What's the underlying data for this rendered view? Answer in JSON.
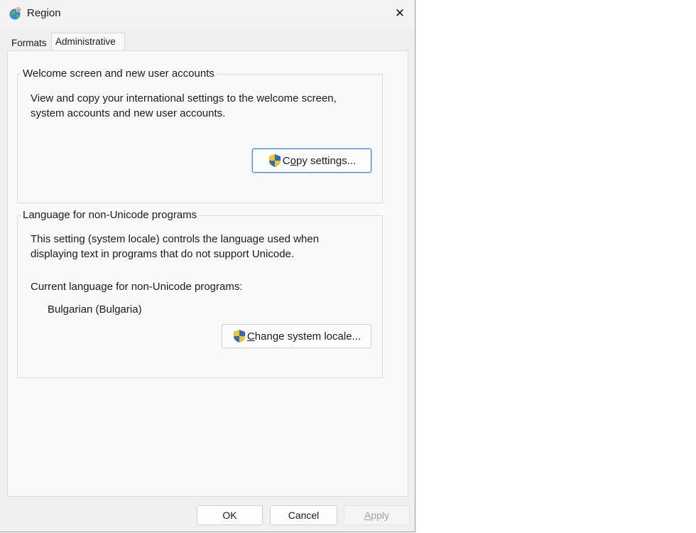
{
  "window": {
    "title": "Region",
    "close_glyph": "✕"
  },
  "tabs": [
    {
      "label": "Formats",
      "active": false
    },
    {
      "label": "Administrative",
      "active": true
    }
  ],
  "welcome_group": {
    "legend": "Welcome screen and new user accounts",
    "description_line1": "View and copy your international settings to the welcome screen,",
    "description_line2": "system accounts and new user accounts.",
    "copy_button_label_prefix": "C",
    "copy_button_label_mnemonic": "o",
    "copy_button_label_suffix": "py settings..."
  },
  "locale_group": {
    "legend": "Language for non-Unicode programs",
    "description_line1": "This setting (system locale) controls the language used when",
    "description_line2": "displaying text in programs that do not support Unicode.",
    "current_label": "Current language for non-Unicode programs:",
    "current_value": "Bulgarian (Bulgaria)",
    "change_button_label_mnemonic": "C",
    "change_button_label_suffix": "hange system locale..."
  },
  "footer": {
    "ok_label": "OK",
    "cancel_label": "Cancel",
    "apply_label_mnemonic": "A",
    "apply_label_suffix": "pply"
  },
  "icons": {
    "app": "globe-icon",
    "shield": "uac-shield-icon",
    "close": "close-icon"
  },
  "colors": {
    "accent_focus": "#4b8ad0",
    "shield_blue": "#2b6cc4",
    "shield_yellow": "#f5c518"
  }
}
